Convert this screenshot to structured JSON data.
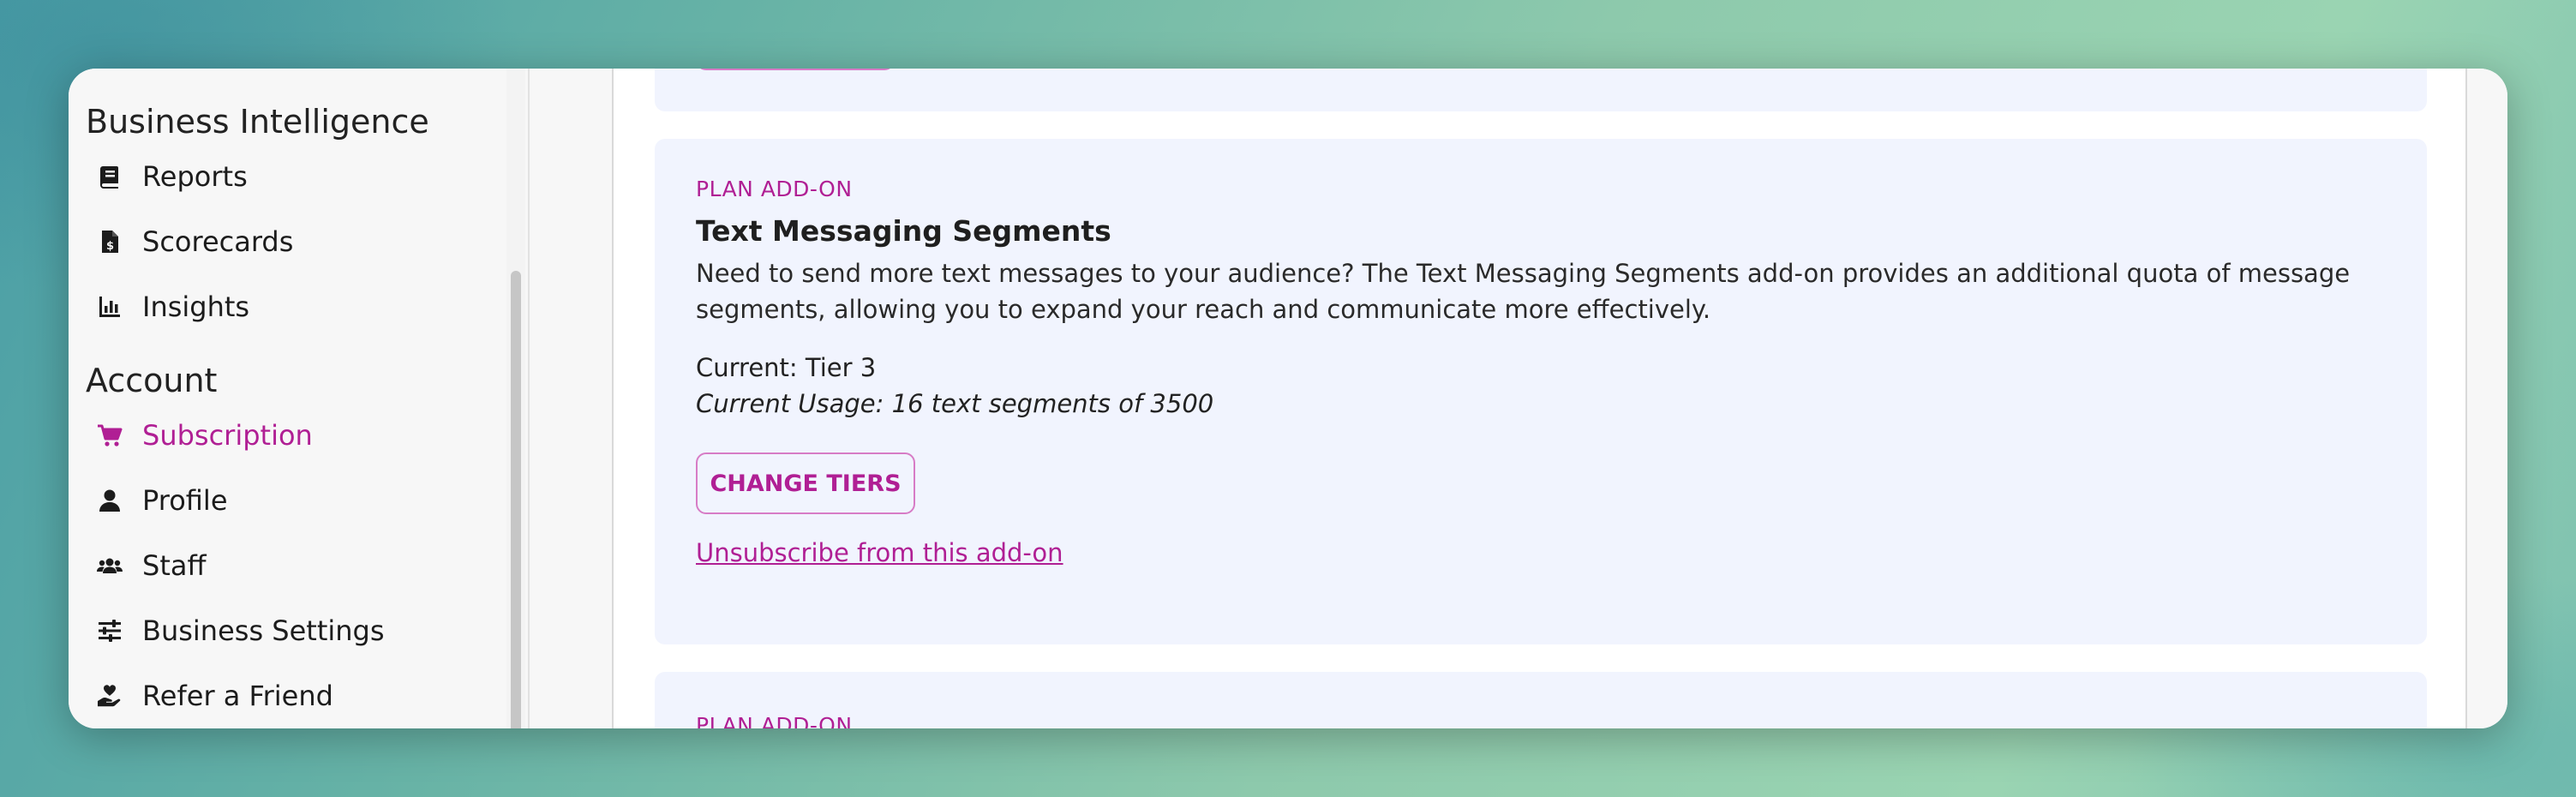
{
  "sidebar": {
    "sections": [
      {
        "heading": "Business Intelligence",
        "items": [
          {
            "label": "Reports",
            "icon": "book-icon"
          },
          {
            "label": "Scorecards",
            "icon": "file-invoice-dollar-icon"
          },
          {
            "label": "Insights",
            "icon": "bar-chart-icon"
          }
        ]
      },
      {
        "heading": "Account",
        "items": [
          {
            "label": "Subscription",
            "icon": "shopping-cart-icon",
            "active": true
          },
          {
            "label": "Profile",
            "icon": "user-icon"
          },
          {
            "label": "Staff",
            "icon": "users-icon"
          },
          {
            "label": "Business Settings",
            "icon": "sliders-icon"
          },
          {
            "label": "Refer a Friend",
            "icon": "hand-holding-heart-icon"
          }
        ]
      }
    ]
  },
  "main": {
    "addon": {
      "eyebrow": "PLAN ADD-ON",
      "title": "Text Messaging Segments",
      "description": "Need to send more text messages to your audience? The Text Messaging Segments add-on provides an additional quota of message segments, allowing you to expand your reach and communicate more effectively.",
      "current_tier": "Current: Tier 3",
      "current_usage": "Current Usage: 16 text segments of 3500",
      "change_button": "CHANGE TIERS",
      "unsubscribe_link": "Unsubscribe from this add-on"
    },
    "next_addon": {
      "eyebrow": "PLAN ADD-ON"
    }
  },
  "colors": {
    "accent": "#b01f94",
    "card_background": "#f1f4fe",
    "sidebar_background": "#f7f7f7"
  }
}
